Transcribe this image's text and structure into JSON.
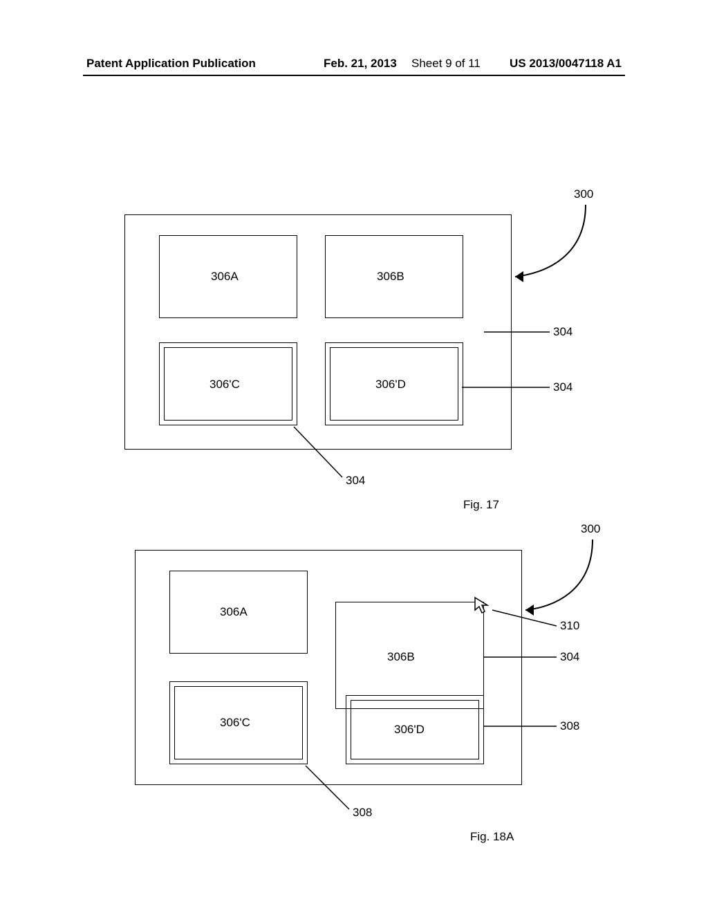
{
  "header": {
    "publication_type": "Patent Application Publication",
    "date": "Feb. 21, 2013",
    "sheet": "Sheet 9 of 11",
    "doc_number": "US 2013/0047118 A1"
  },
  "figures": {
    "fig17": {
      "caption": "Fig. 17",
      "labels": {
        "l300": "300",
        "l304a": "304",
        "l304b": "304",
        "l304c": "304"
      },
      "cells": {
        "a": "306A",
        "b": "306B",
        "c": "306'C",
        "d": "306'D"
      }
    },
    "fig18a": {
      "caption": "Fig. 18A",
      "labels": {
        "l300": "300",
        "l310": "310",
        "l304": "304",
        "l308a": "308",
        "l308b": "308"
      },
      "cells": {
        "a": "306A",
        "b": "306B",
        "c": "306'C",
        "d": "306'D"
      }
    }
  }
}
